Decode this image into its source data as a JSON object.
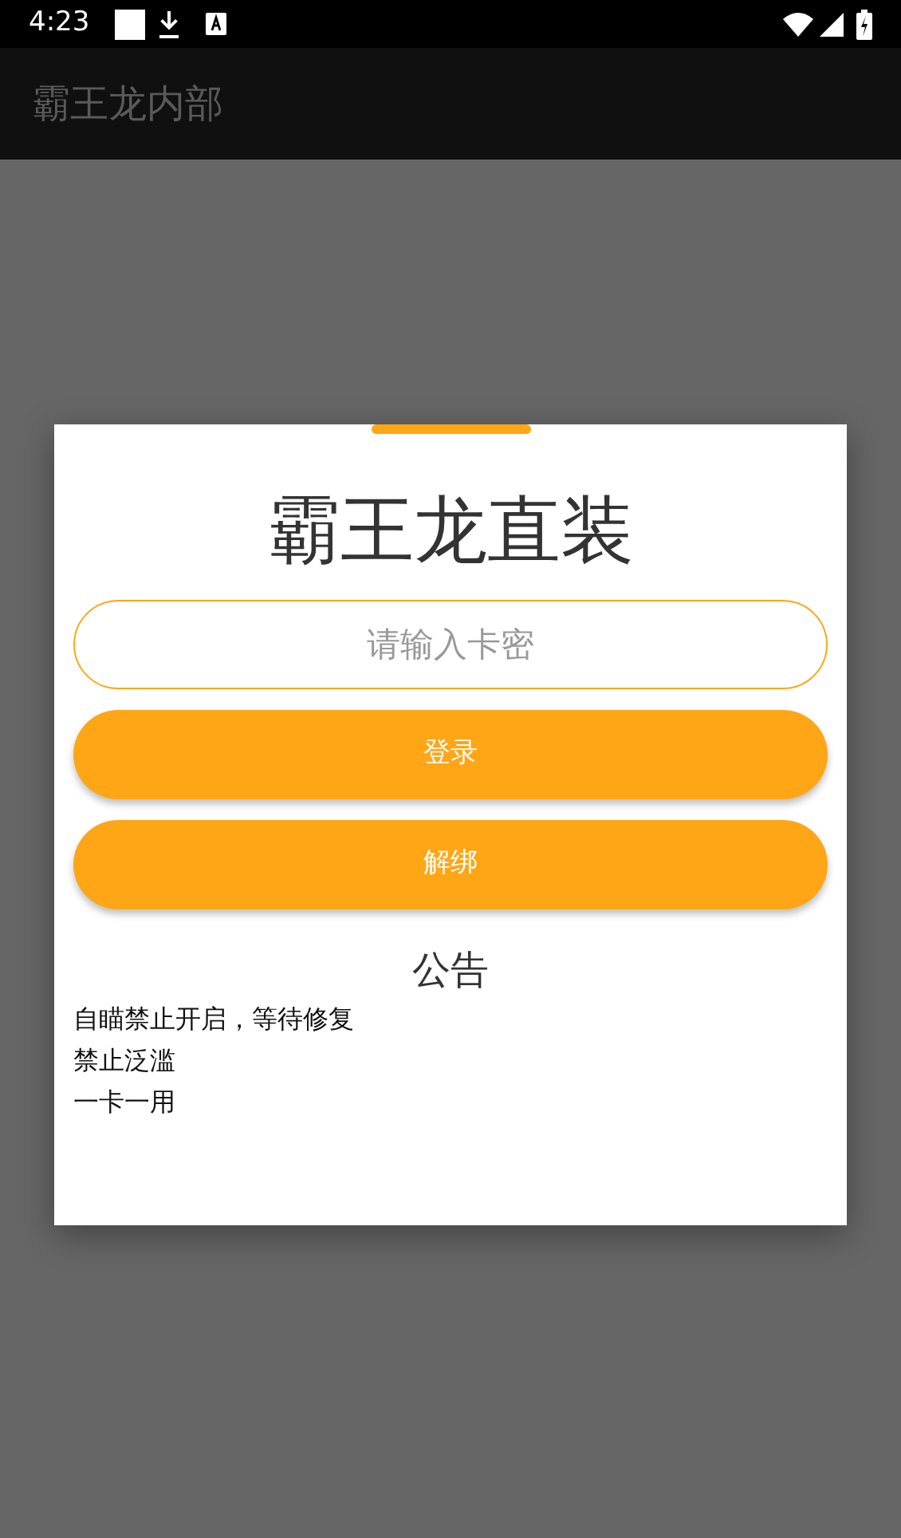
{
  "status_bar": {
    "time": "4:23"
  },
  "app_bar": {
    "title": "霸王龙内部"
  },
  "dialog": {
    "title": "霸王龙直装",
    "card_field": {
      "placeholder": "请输入卡密"
    },
    "buttons": [
      {
        "label": "登录"
      },
      {
        "label": "解绑"
      }
    ],
    "notice": {
      "heading": "公告",
      "lines": [
        "自瞄禁止开启，等待修复",
        "禁止泛滥",
        "一卡一用"
      ]
    }
  }
}
